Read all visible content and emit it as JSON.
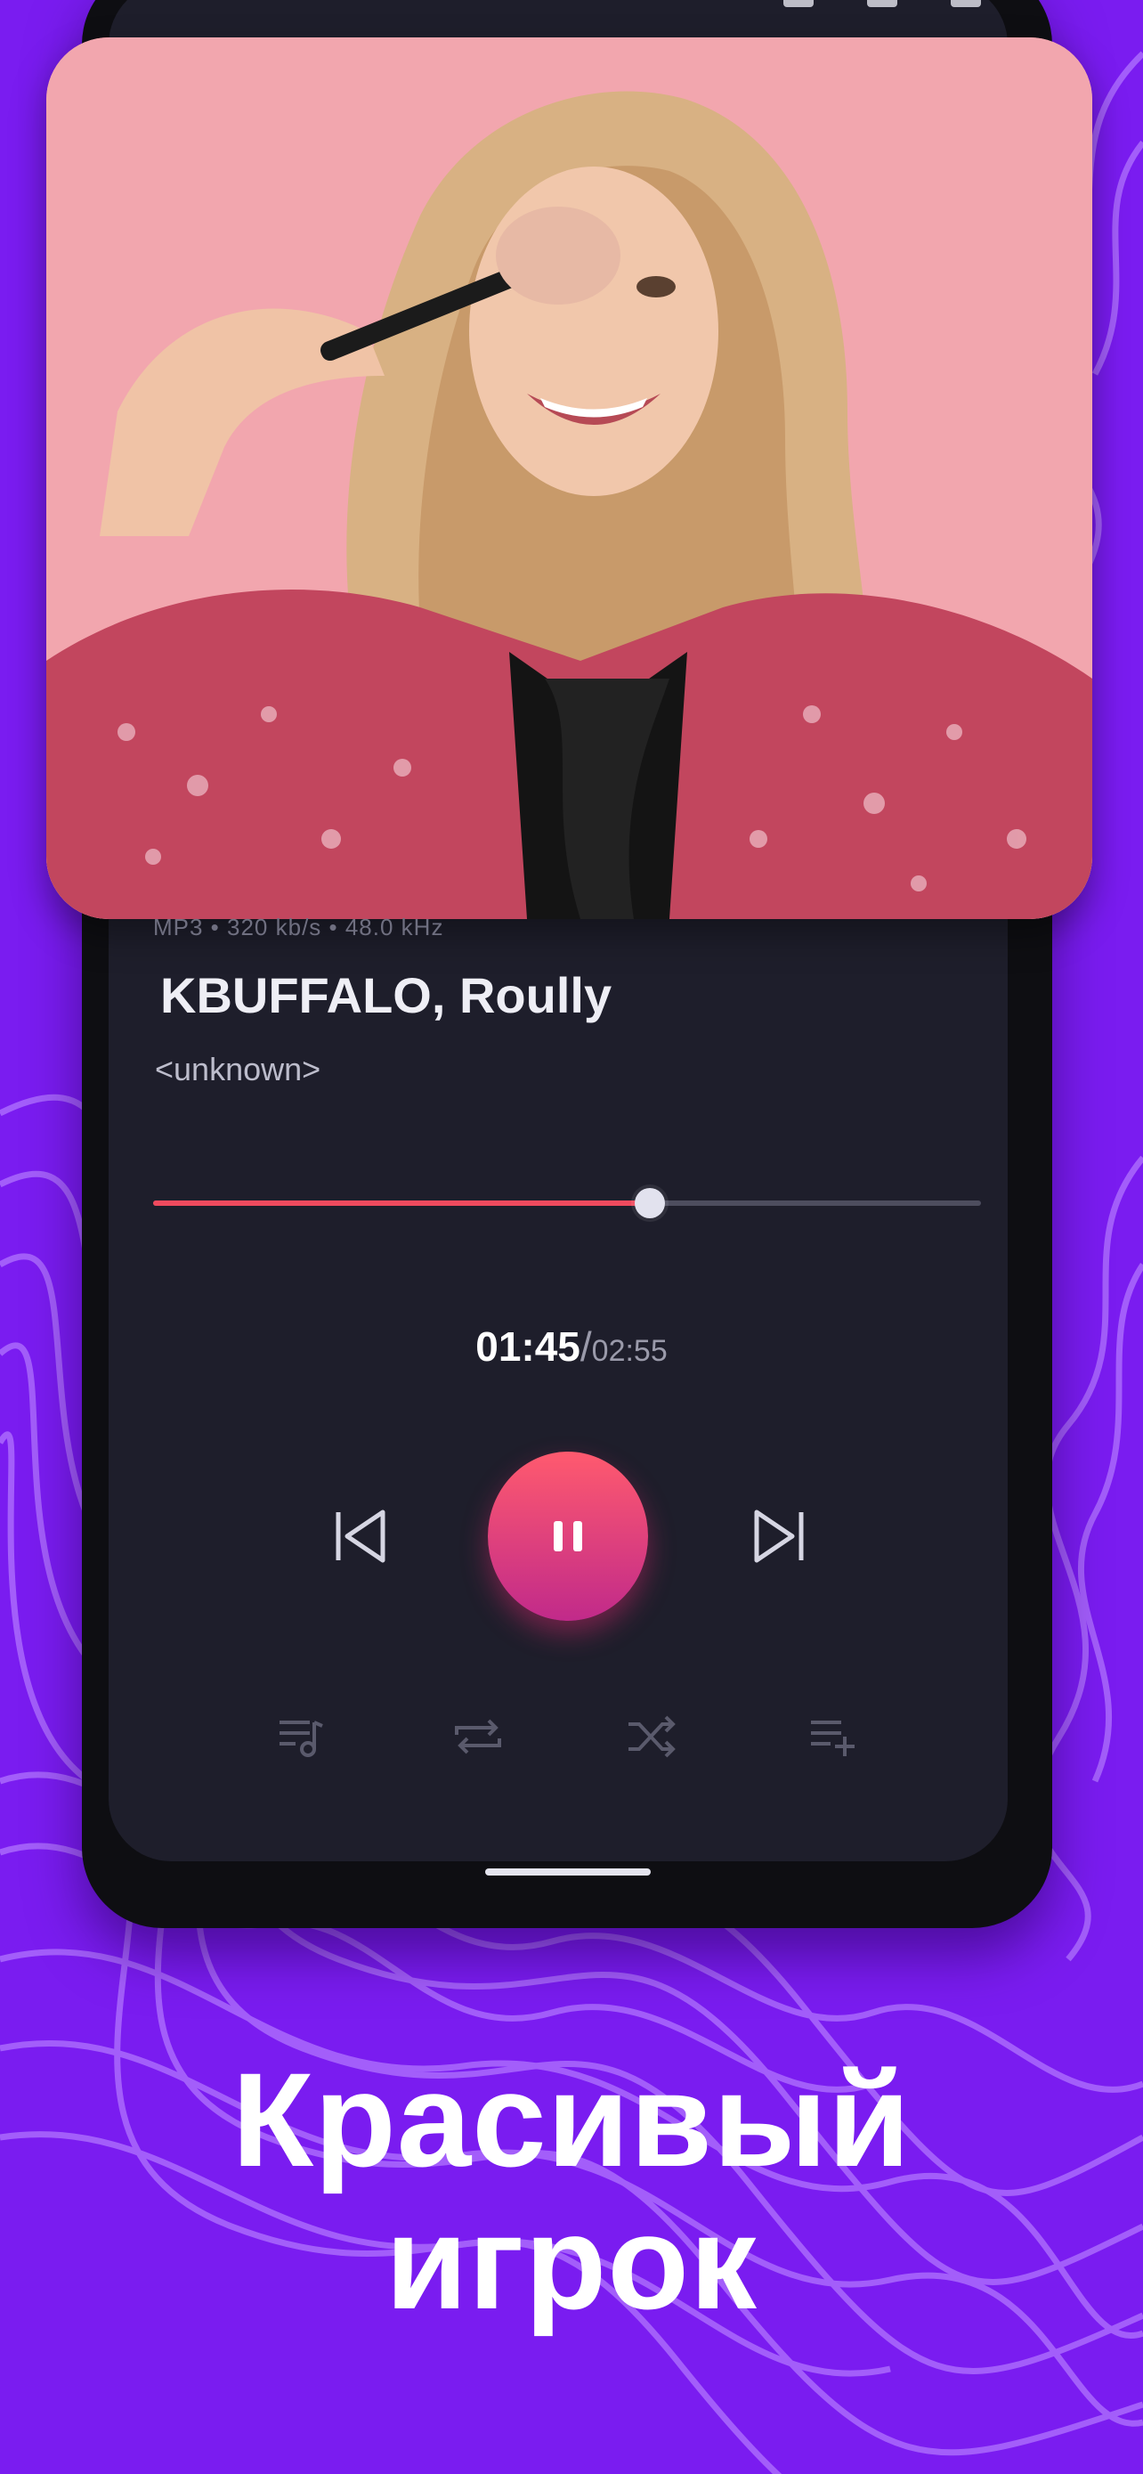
{
  "player": {
    "meta": "MP3 • 320 kb/s • 48.0 kHz",
    "title": "KBUFFALO, Roully",
    "artist": "<unknown>",
    "progress_fraction": 0.6,
    "current_time": "01:45",
    "separator": "/",
    "total_time": "02:55",
    "icons": {
      "prev": "skip-previous-icon",
      "play_pause": "pause-icon",
      "next": "skip-next-icon",
      "queue": "queue-music-icon",
      "repeat": "repeat-icon",
      "shuffle": "shuffle-icon",
      "add_to_playlist": "playlist-add-icon"
    }
  },
  "promo": {
    "line1": "Красивый",
    "line2": "игрок"
  },
  "colors": {
    "background": "#7a1cf0",
    "screen": "#1e1e2b",
    "accent": "#ef4a5e",
    "play_gradient_end": "#c12a8a"
  }
}
